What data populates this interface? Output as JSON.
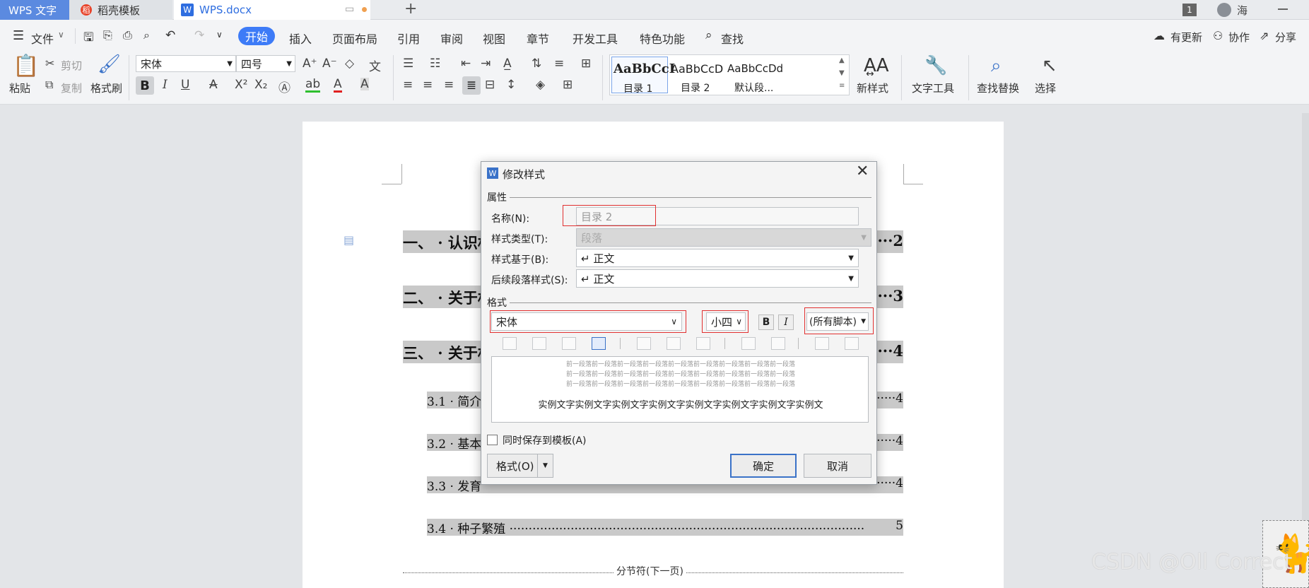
{
  "tabs": {
    "wps": "WPS 文字",
    "template": "稻壳模板",
    "doc": "WPS.docx",
    "new_tab": "+"
  },
  "titlebar": {
    "badge": "1",
    "user": "海"
  },
  "menu": {
    "file": "文件",
    "items": [
      "开始",
      "插入",
      "页面布局",
      "引用",
      "审阅",
      "视图",
      "章节",
      "开发工具",
      "特色功能"
    ],
    "search": "查找",
    "right": [
      "有更新",
      "协作",
      "分享"
    ]
  },
  "ribbon": {
    "paste": "粘贴",
    "cut": "剪切",
    "copy": "复制",
    "format_painter": "格式刷",
    "font": "宋体",
    "size": "四号",
    "styles": [
      {
        "preview": "AaBbCcI",
        "label": "目录 1"
      },
      {
        "preview": "AaBbCcD",
        "label": "目录 2"
      },
      {
        "preview": "AaBbCcDd",
        "label": "默认段..."
      }
    ],
    "new_style": "新样式",
    "text_tools": "文字工具",
    "find_replace": "查找替换",
    "select": "选择"
  },
  "document": {
    "toc": [
      {
        "text": "一、 · 认识相",
        "page": "···2"
      },
      {
        "text": "二、 · 关于相",
        "page": "···3"
      },
      {
        "text": "三、 · 关于相",
        "page": "···4"
      },
      {
        "text": "3.1 · 简介",
        "page": "·····4"
      },
      {
        "text": "3.2 · 基本特",
        "page": "·····4"
      },
      {
        "text": "3.3 · 发育",
        "page": "·····4"
      },
      {
        "text": "3.4 · 种子繁殖 ·····························································································",
        "page": "5"
      }
    ],
    "section_break": "分节符(下一页)"
  },
  "dialog": {
    "title": "修改样式",
    "attributes_label": "属性",
    "name_label": "名称(N):",
    "name_value": "目录 2",
    "type_label": "样式类型(T):",
    "type_value": "段落",
    "based_label": "样式基于(B):",
    "based_value": "↵ 正文",
    "next_label": "后续段落样式(S):",
    "next_value": "↵ 正文",
    "format_label": "格式",
    "font": "宋体",
    "size": "小四",
    "bold": "B",
    "italic": "I",
    "script": "(所有脚本)",
    "preview_prev": "前一段落前一段落前一段落前一段落前一段落前一段落前一段落前一段落前一段落",
    "preview_sample": "实例文字实例文字实例文字实例文字实例文字实例文字实例文字实例文",
    "save_template": "同时保存到模板(A)",
    "format_button": "格式(O)",
    "ok": "确定",
    "cancel": "取消"
  },
  "watermark": "CSDN @Oll Correct"
}
